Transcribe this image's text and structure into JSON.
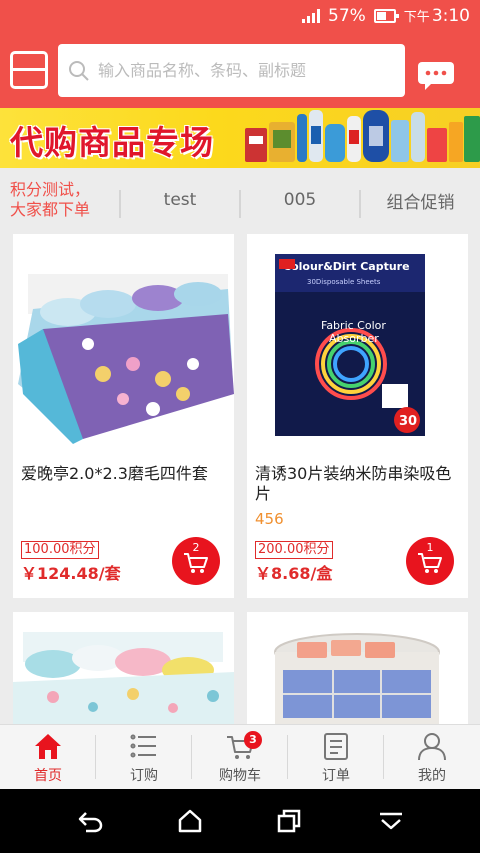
{
  "status_bar": {
    "battery_percent": "57%",
    "battery_level": 0.57,
    "time_period": "下午",
    "time": "3:10"
  },
  "header": {
    "search_placeholder": "输入商品名称、条码、副标题",
    "accent_color": "#f0504a"
  },
  "banner": {
    "title": "代购商品专场"
  },
  "categories": [
    {
      "label": "积分测试，\n大家都下单",
      "active": true
    },
    {
      "label": "test"
    },
    {
      "label": "005"
    },
    {
      "label": "组合促销"
    }
  ],
  "products": [
    {
      "title": "爱晚亭2.0*2.3磨毛四件套",
      "subtitle": "",
      "points": "100.00积分",
      "price": "￥124.48/套",
      "cart_count": "2",
      "image_icon": "bedding-set-photo"
    },
    {
      "title": "清诱30片装纳米防串染吸色片",
      "subtitle": "456",
      "points": "200.00积分",
      "price": "￥8.68/盒",
      "cart_count": "1",
      "image_icon": "color-catcher-box-photo",
      "image_text": {
        "line1": "Colour&Dirt Capture",
        "line2": "30Disposable Sheets",
        "line3": "Fabric Color",
        "line4": "Absorber",
        "badge": "30"
      }
    },
    {
      "image_icon": "bedding-set-photo-2"
    },
    {
      "image_icon": "storage-box-photo"
    }
  ],
  "bottom_nav": [
    {
      "label": "首页",
      "icon": "home-icon",
      "active": true
    },
    {
      "label": "订购",
      "icon": "list-icon"
    },
    {
      "label": "购物车",
      "icon": "cart-icon",
      "badge": "3"
    },
    {
      "label": "订单",
      "icon": "order-icon"
    },
    {
      "label": "我的",
      "icon": "user-icon"
    }
  ]
}
